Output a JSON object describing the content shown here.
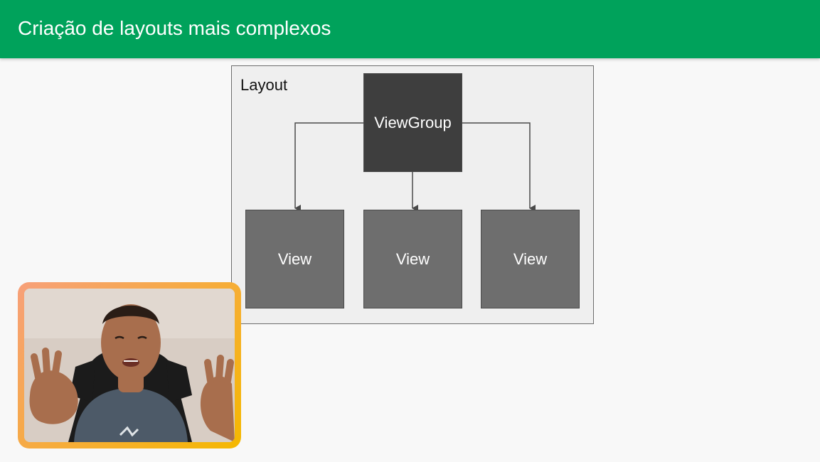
{
  "slide": {
    "title": "Criação de layouts mais complexos"
  },
  "diagram": {
    "label": "Layout",
    "root_label": "ViewGroup",
    "children": [
      {
        "label": "View"
      },
      {
        "label": "View"
      },
      {
        "label": "View"
      }
    ]
  },
  "colors": {
    "title_bar": "#00a25b",
    "slide_bg": "#f8f8f8",
    "diagram_bg": "#efefef",
    "root_fill": "#3e3e3e",
    "child_fill": "#6e6e6e",
    "connector": "#4a4a4a",
    "webcam_border_start": "#f7a07a",
    "webcam_border_end": "#f5b800"
  },
  "webcam": {
    "shirt_color": "#4d5a68",
    "chair_color": "#1b1b1b",
    "skin_color": "#a86e4d"
  }
}
